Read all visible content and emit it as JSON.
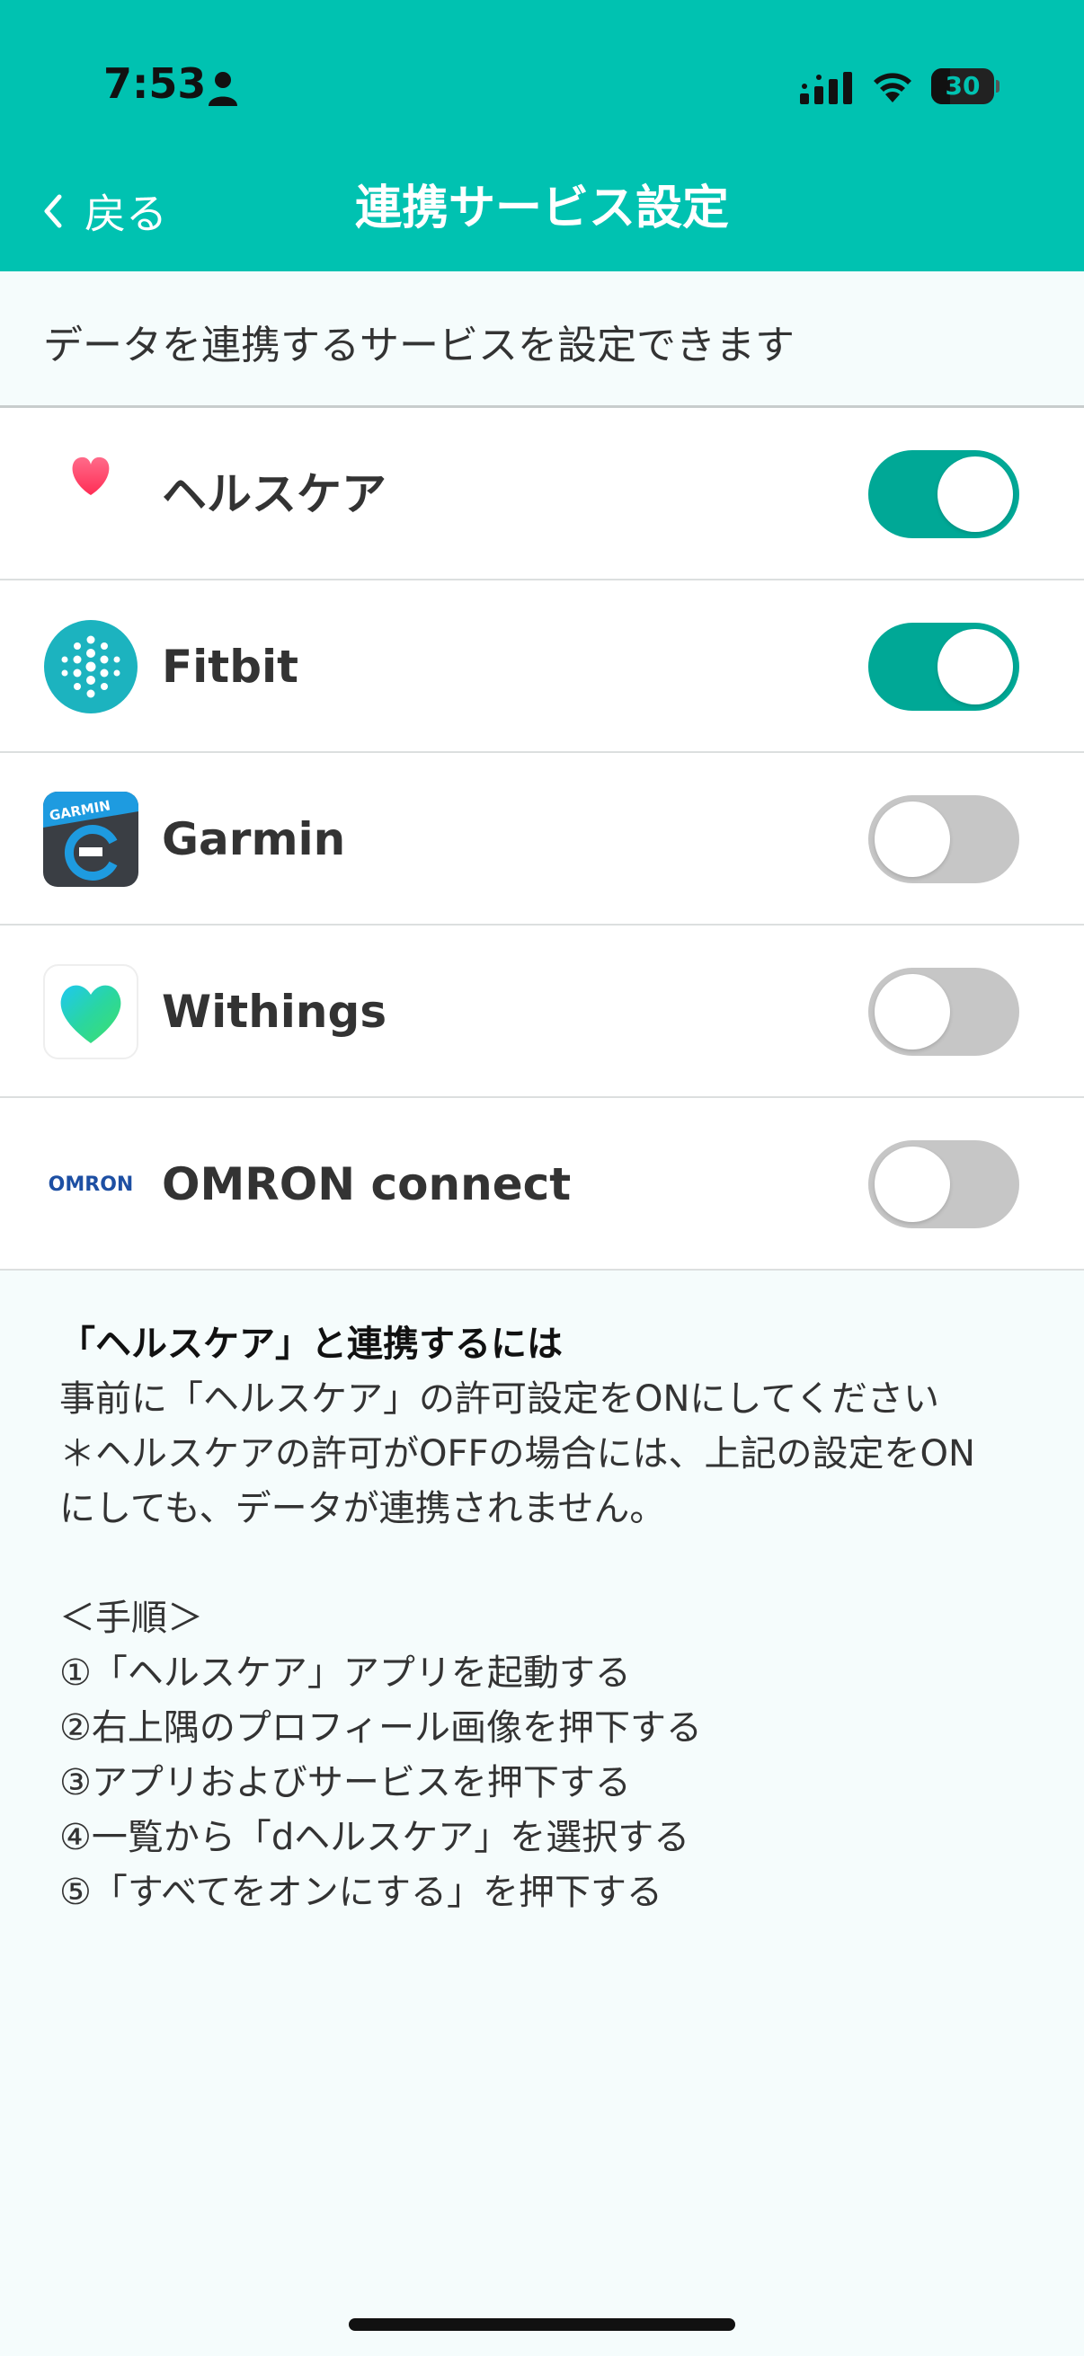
{
  "status_bar": {
    "time": "7:53",
    "battery": "30",
    "battery_percent": 30
  },
  "nav": {
    "back_label": "戻る",
    "title": "連携サービス設定"
  },
  "intro": {
    "text": "データを連携するサービスを設定できます"
  },
  "services": [
    {
      "name": "ヘルスケア",
      "enabled": true,
      "icon": "heart-icon"
    },
    {
      "name": "Fitbit",
      "enabled": true,
      "icon": "fitbit-logo-icon"
    },
    {
      "name": "Garmin",
      "enabled": false,
      "icon": "garmin-logo-icon",
      "icon_text": "GARMIN"
    },
    {
      "name": "Withings",
      "enabled": false,
      "icon": "withings-heart-icon"
    },
    {
      "name": "OMRON connect",
      "enabled": false,
      "icon": "omron-logo-icon",
      "icon_text": "OMRON"
    }
  ],
  "notes": {
    "heading": "「ヘルスケア」と連携するには",
    "lines": [
      "事前に「ヘルスケア」の許可設定をONにしてください",
      "＊ヘルスケアの許可がOFFの場合には、上記の設定をON",
      "にしても、データが連携されません。"
    ],
    "steps_title": "＜手順＞",
    "steps": [
      "①「ヘルスケア」アプリを起動する",
      "②右上隅のプロフィール画像を押下する",
      "③アプリおよびサービスを押下する",
      "④一覧から「dヘルスケア」を選択する",
      "⑤「すべてをオンにする」を押下する"
    ]
  },
  "colors": {
    "header": "#00c2b1",
    "toggle_on": "#00a896",
    "toggle_off": "#c6c6c6",
    "background": "#f5fcfc"
  }
}
